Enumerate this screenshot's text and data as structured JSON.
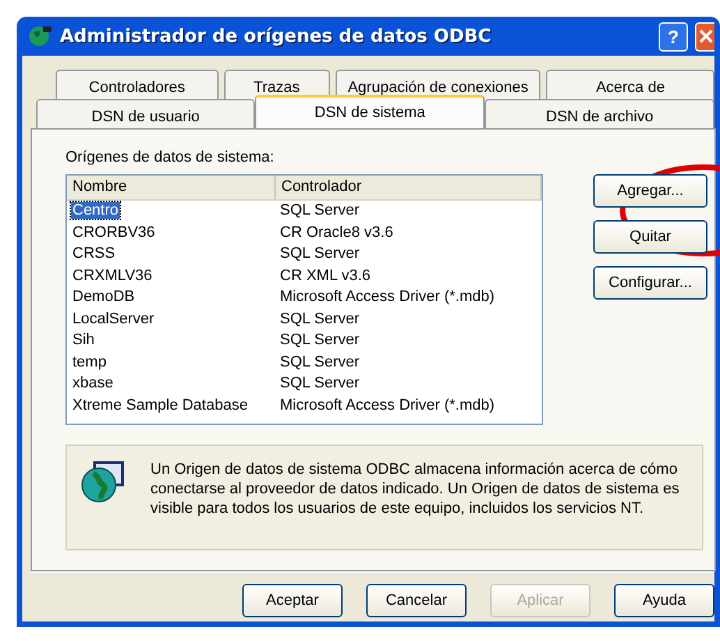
{
  "window": {
    "title": "Administrador de orígenes de datos ODBC",
    "help_button": "?"
  },
  "tab_rows": [
    {
      "tabs": [
        {
          "label": "Controladores",
          "selected": false
        },
        {
          "label": "Trazas",
          "selected": false
        },
        {
          "label": "Agrupación de conexiones",
          "selected": false
        },
        {
          "label": "Acerca de",
          "selected": false
        }
      ]
    },
    {
      "tabs": [
        {
          "label": "DSN de usuario",
          "selected": false
        },
        {
          "label": "DSN de sistema",
          "selected": true
        },
        {
          "label": "DSN de archivo",
          "selected": false
        }
      ]
    }
  ],
  "list": {
    "label": "Orígenes de datos de sistema:",
    "columns": [
      "Nombre",
      "Controlador"
    ],
    "rows": [
      {
        "name": "Centro",
        "driver": "SQL Server",
        "selected": true
      },
      {
        "name": "CRORBV36",
        "driver": "CR Oracle8 v3.6",
        "selected": false
      },
      {
        "name": "CRSS",
        "driver": "SQL Server",
        "selected": false
      },
      {
        "name": "CRXMLV36",
        "driver": "CR XML v3.6",
        "selected": false
      },
      {
        "name": "DemoDB",
        "driver": "Microsoft Access Driver (*.mdb)",
        "selected": false
      },
      {
        "name": "LocalServer",
        "driver": "SQL Server",
        "selected": false
      },
      {
        "name": "Sih",
        "driver": "SQL Server",
        "selected": false
      },
      {
        "name": "temp",
        "driver": "SQL Server",
        "selected": false
      },
      {
        "name": "xbase",
        "driver": "SQL Server",
        "selected": false
      },
      {
        "name": "Xtreme Sample Database",
        "driver": "Microsoft Access Driver (*.mdb)",
        "selected": false
      }
    ]
  },
  "side_buttons": [
    {
      "label": "Agregar...",
      "disabled": false
    },
    {
      "label": "Quitar",
      "disabled": false
    },
    {
      "label": "Configurar...",
      "disabled": false
    }
  ],
  "info": {
    "text": "Un Origen de datos de sistema ODBC almacena información acerca de cómo conectarse al proveedor de datos indicado. Un Origen de datos de sistema es visible para todos los usuarios de este equipo, incluidos los servicios NT."
  },
  "buttons": [
    {
      "label": "Aceptar",
      "disabled": false
    },
    {
      "label": "Cancelar",
      "disabled": false
    },
    {
      "label": "Aplicar",
      "disabled": true
    },
    {
      "label": "Ayuda",
      "disabled": false
    }
  ],
  "annotation": {
    "kind": "ellipse"
  }
}
